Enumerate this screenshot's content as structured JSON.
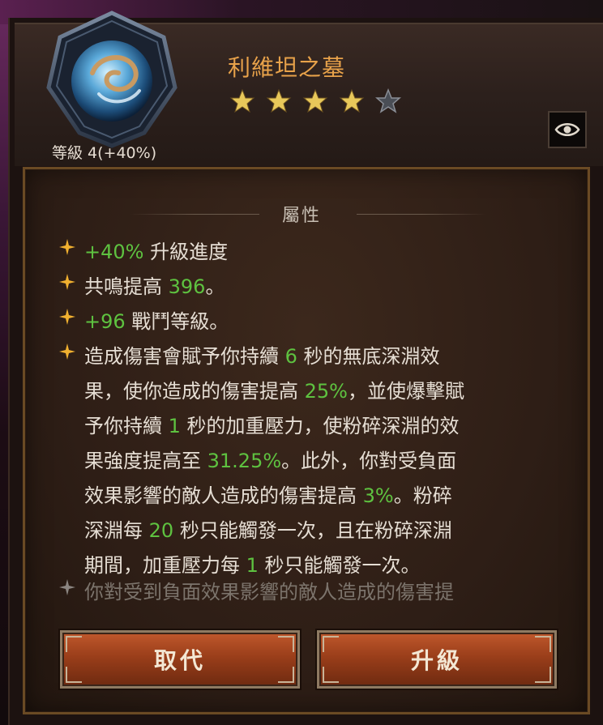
{
  "header": {
    "name": "利維坦之墓",
    "level": "等級 4(+40%)",
    "stars_filled": 4,
    "stars_total": 5,
    "icon": "eye-icon"
  },
  "section": {
    "title": "屬性"
  },
  "affixes": [
    {
      "parts": [
        {
          "t": "+40%",
          "g": true
        },
        {
          "t": " 升級進度",
          "g": false
        }
      ]
    },
    {
      "parts": [
        {
          "t": "共鳴提高 ",
          "g": false
        },
        {
          "t": "396",
          "g": true
        },
        {
          "t": "。",
          "g": false
        }
      ]
    },
    {
      "parts": [
        {
          "t": "+96",
          "g": true
        },
        {
          "t": " 戰鬥等級。",
          "g": false
        }
      ]
    },
    {
      "lines": [
        [
          {
            "t": "造成傷害會賦予你持續 ",
            "g": false
          },
          {
            "t": "6",
            "g": true
          },
          {
            "t": " 秒的無底深淵效",
            "g": false
          }
        ],
        [
          {
            "t": "果，使你造成的傷害提高 ",
            "g": false
          },
          {
            "t": "25%",
            "g": true
          },
          {
            "t": "，並使爆擊賦",
            "g": false
          }
        ],
        [
          {
            "t": "予你持續 ",
            "g": false
          },
          {
            "t": "1",
            "g": true
          },
          {
            "t": " 秒的加重壓力，使粉碎深淵的效",
            "g": false
          }
        ],
        [
          {
            "t": "果強度提高至 ",
            "g": false
          },
          {
            "t": "31.25%",
            "g": true
          },
          {
            "t": "。此外，你對受負面",
            "g": false
          }
        ],
        [
          {
            "t": "效果影響的敵人造成的傷害提高 ",
            "g": false
          },
          {
            "t": "3%",
            "g": true
          },
          {
            "t": "。粉碎",
            "g": false
          }
        ],
        [
          {
            "t": "深淵每 ",
            "g": false
          },
          {
            "t": "20",
            "g": true
          },
          {
            "t": " 秒只能觸發一次，且在粉碎深淵",
            "g": false
          }
        ],
        [
          {
            "t": "期間，加重壓力每 ",
            "g": false
          },
          {
            "t": "1",
            "g": true
          },
          {
            "t": " 秒只能觸發一次。",
            "g": false
          }
        ]
      ]
    }
  ],
  "inactive_affix": "你對受到負面效果影響的敵人造成的傷害提",
  "buttons": {
    "replace": "取代",
    "upgrade": "升級"
  },
  "colors": {
    "title": "#e8a24a",
    "highlight": "#5ec240",
    "button": "#9a3e1a",
    "frame": "#6a4a24"
  }
}
